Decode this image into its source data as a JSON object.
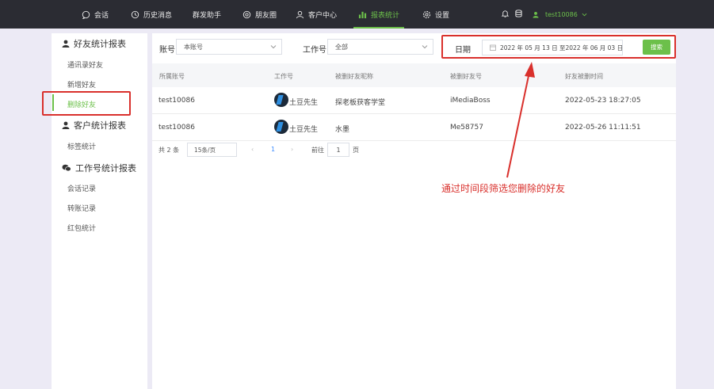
{
  "nav": {
    "items": [
      {
        "label": "会话",
        "icon": "chat-icon"
      },
      {
        "label": "历史消息",
        "icon": "clock-icon"
      },
      {
        "label": "群发助手",
        "icon": ""
      },
      {
        "label": "朋友圈",
        "icon": "aperture-icon"
      },
      {
        "label": "客户中心",
        "icon": "user-icon"
      },
      {
        "label": "报表统计",
        "icon": "bar-chart-icon"
      },
      {
        "label": "设置",
        "icon": "gear-icon"
      }
    ],
    "active": "报表统计",
    "username": "test10086",
    "accent_color": "#6cc04a"
  },
  "sidebar": {
    "sections": [
      {
        "title": "好友统计报表",
        "icon": "user-icon",
        "items": [
          "通讯录好友",
          "新增好友",
          "删除好友"
        ]
      },
      {
        "title": "客户统计报表",
        "icon": "user-icon",
        "items": [
          "标签统计"
        ]
      },
      {
        "title": "工作号统计报表",
        "icon": "wechat-icon",
        "items": [
          "会话记录",
          "转账记录",
          "红包统计"
        ]
      }
    ],
    "active_item": "删除好友"
  },
  "filters": {
    "account_label": "账号",
    "account_value": "本账号",
    "work_label": "工作号",
    "work_value": "全部",
    "date_label": "日期",
    "date_range": "2022 年 05 月 13 日 至2022 年 06 月 03 日",
    "search_button": "搜索"
  },
  "table": {
    "headers": [
      "所属账号",
      "工作号",
      "被删好友昵称",
      "被删好友号",
      "好友被删时间"
    ],
    "rows": [
      {
        "account": "test10086",
        "work": "土豆先生",
        "nickname": "探老板获客学堂",
        "friend_id": "iMediaBoss",
        "time": "2022-05-23 18:27:05"
      },
      {
        "account": "test10086",
        "work": "土豆先生",
        "nickname": "水墨",
        "friend_id": "Me58757",
        "time": "2022-05-26 11:11:51"
      }
    ]
  },
  "pager": {
    "total": "共 2 条",
    "page_size": "15条/页",
    "prev": "‹",
    "current": "1",
    "next": "›",
    "goto_label": "前往",
    "goto_value": "1",
    "page_suffix": "页"
  },
  "annotation": {
    "text": "通过时间段筛选您删除的好友",
    "color": "#d9302c"
  }
}
